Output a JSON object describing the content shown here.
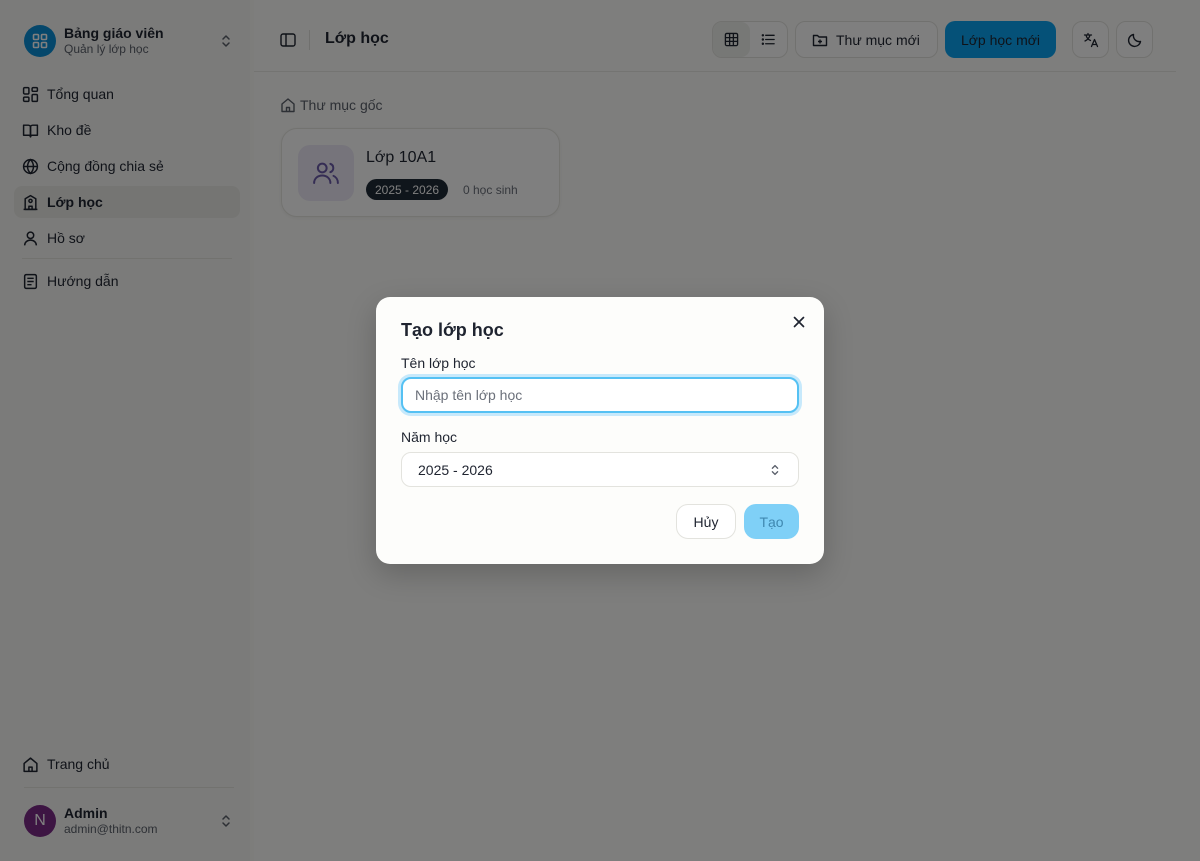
{
  "sidebar": {
    "brand_title": "Bảng giáo viên",
    "brand_subtitle": "Quản lý lớp học",
    "items": [
      {
        "label": "Tổng quan",
        "icon": "dashboard-icon"
      },
      {
        "label": "Kho đề",
        "icon": "book-icon"
      },
      {
        "label": "Cộng đồng chia sẻ",
        "icon": "globe-icon"
      },
      {
        "label": "Lớp học",
        "icon": "school-icon",
        "active": true
      },
      {
        "label": "Hồ sơ",
        "icon": "user-icon"
      },
      {
        "label": "Hướng dẫn",
        "icon": "document-icon"
      }
    ],
    "home_label": "Trang chủ",
    "user": {
      "initial": "N",
      "name": "Admin",
      "email": "admin@thitn.com"
    }
  },
  "header": {
    "title": "Lớp học",
    "new_folder_label": "Thư mục mới",
    "new_class_label": "Lớp học mới"
  },
  "breadcrumb": {
    "root_label": "Thư mục gốc"
  },
  "classes": [
    {
      "name": "Lớp 10A1",
      "year": "2025 - 2026",
      "students": "0 học sinh"
    }
  ],
  "dialog": {
    "title": "Tạo lớp học",
    "name_label": "Tên lớp học",
    "name_placeholder": "Nhập tên lớp học",
    "name_value": "",
    "year_label": "Năm học",
    "year_value": "2025 - 2026",
    "cancel_label": "Hủy",
    "create_label": "Tạo"
  },
  "colors": {
    "primary": "#0aa3f0",
    "primary_disabled": "#7fd0f7",
    "badge": "#1f2a36",
    "avatar": "#7a2a86"
  }
}
